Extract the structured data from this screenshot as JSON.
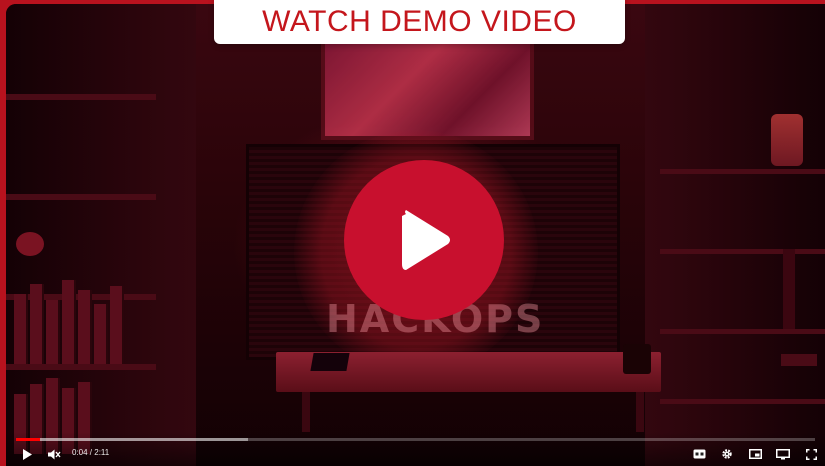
{
  "banner": {
    "label": "WATCH DEMO VIDEO"
  },
  "video": {
    "brand_text": "HACKOPS",
    "progress_played": 0.03,
    "progress_buffered": 0.29
  },
  "controls": {
    "time_label": "0:04 / 2:11",
    "play_icon": "play-icon",
    "mute_icon": "muted-volume-icon",
    "cc_icon": "captions-icon",
    "settings_icon": "gear-icon",
    "miniplayer_icon": "miniplayer-icon",
    "theater_icon": "theater-mode-icon",
    "fullscreen_icon": "fullscreen-icon"
  },
  "colors": {
    "accent": "#c4161c",
    "play_button": "#c8102e",
    "progress": "#ff0000"
  }
}
